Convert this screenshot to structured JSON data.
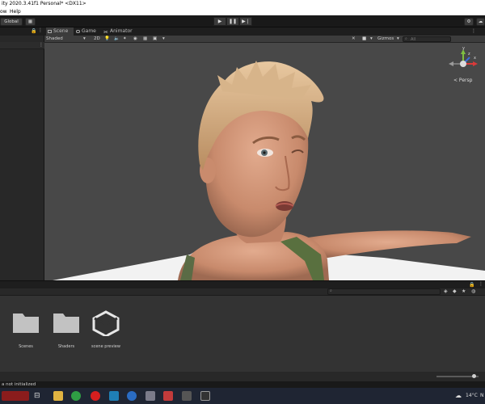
{
  "window": {
    "title": "ity 2020.3.41f1 Personal* <DX11>"
  },
  "menu": [
    {
      "label": "ow"
    },
    {
      "label": "Help"
    }
  ],
  "toolbar": {
    "global_label": "Global",
    "play_icons": [
      "▶",
      "❚❚",
      "▶❘"
    ]
  },
  "scene": {
    "tabs": [
      {
        "label": "Scene"
      },
      {
        "label": "Game"
      },
      {
        "label": "Animator"
      }
    ],
    "shading_mode": "Shaded",
    "mode_2d": "2D",
    "gizmos_label": "Gizmos",
    "search_placeholder": "All",
    "persp_label": "< Persp",
    "axis_labels": {
      "y": "y",
      "x": "x",
      "z": "z"
    }
  },
  "project": {
    "assets": [
      {
        "label": "Scenes",
        "icon": "folder-icon"
      },
      {
        "label": "Shaders",
        "icon": "folder-icon"
      },
      {
        "label": "scene preview",
        "icon": "unity-logo-icon"
      }
    ]
  },
  "status": {
    "message": "a not initialized"
  },
  "taskbar": {
    "temperature": "14°C",
    "clock_fragment": "N"
  },
  "colors": {
    "viewport_bg": "#484848",
    "panel_bg": "#333333",
    "taskbar_bg": "#1f2533"
  }
}
